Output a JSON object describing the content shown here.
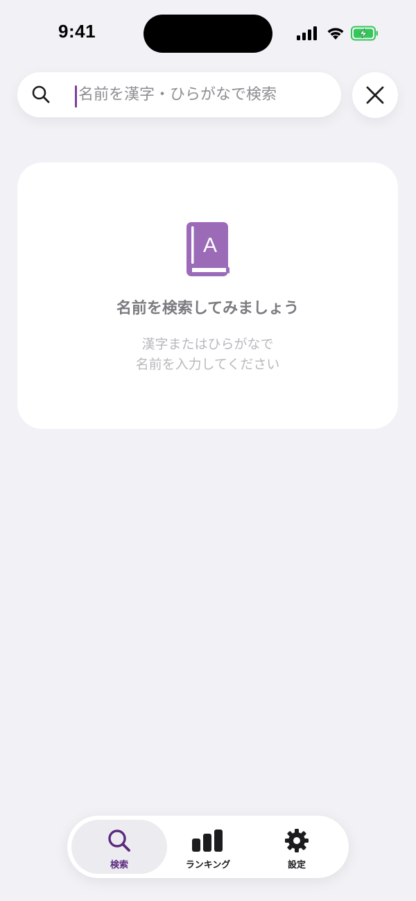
{
  "status_bar": {
    "time": "9:41"
  },
  "search": {
    "placeholder": "名前を漢字・ひらがなで検索",
    "value": ""
  },
  "empty_state": {
    "title": "名前を検索してみましょう",
    "description_line1": "漢字またはひらがなで",
    "description_line2": "名前を入力してください",
    "icon": "book-letter-a-icon"
  },
  "tab_bar": {
    "tabs": [
      {
        "label": "検索",
        "icon": "search-icon",
        "active": true
      },
      {
        "label": "ランキング",
        "icon": "bar-chart-icon",
        "active": false
      },
      {
        "label": "設定",
        "icon": "gear-icon",
        "active": false
      }
    ]
  },
  "colors": {
    "accent": "#7b3f9e",
    "book_icon": "#9b6bb8",
    "background": "#f1f1f6",
    "battery": "#34c759"
  }
}
